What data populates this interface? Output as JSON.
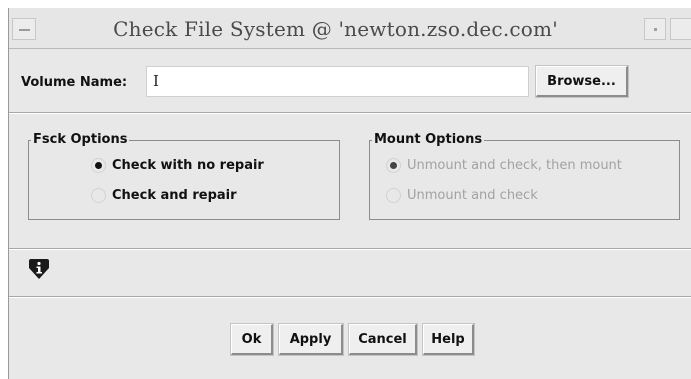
{
  "window": {
    "title": "Check File System @ 'newton.zso.dec.com'"
  },
  "volume": {
    "label": "Volume Name:",
    "value": "",
    "browse_label": "Browse..."
  },
  "fsck": {
    "legend": "Fsck Options",
    "options": [
      {
        "label": "Check with no repair",
        "selected": true
      },
      {
        "label": "Check and repair",
        "selected": false
      }
    ]
  },
  "mount": {
    "legend": "Mount Options",
    "enabled": false,
    "options": [
      {
        "label": "Unmount and check, then mount",
        "selected": true
      },
      {
        "label": "Unmount and check",
        "selected": false
      }
    ]
  },
  "status": {
    "icon": "info-icon",
    "message": ""
  },
  "buttons": {
    "ok": "Ok",
    "apply": "Apply",
    "cancel": "Cancel",
    "help": "Help"
  }
}
